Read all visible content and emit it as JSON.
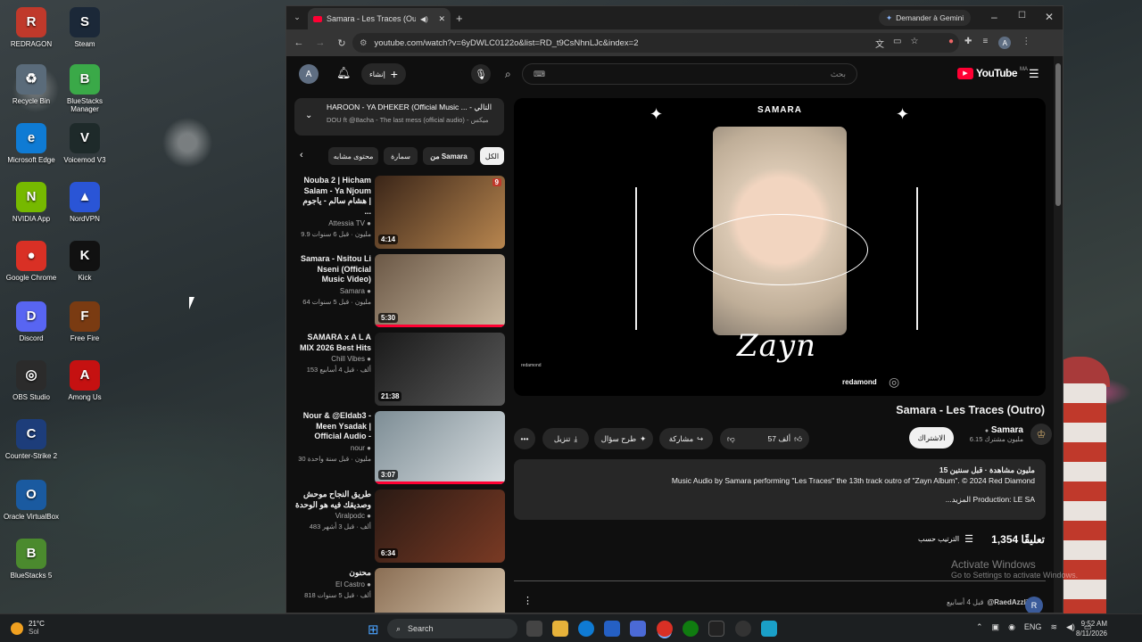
{
  "desktop": {
    "icons": [
      {
        "label": "REDRAGON",
        "glyph": "R",
        "color": "#c0392b"
      },
      {
        "label": "Steam",
        "glyph": "S",
        "color": "#1b2838"
      },
      {
        "label": "Recycle Bin",
        "glyph": "♻",
        "color": "#5a6b7a"
      },
      {
        "label": "BlueStacks Manager",
        "glyph": "B",
        "color": "#3aa948"
      },
      {
        "label": "Microsoft Edge",
        "glyph": "e",
        "color": "#0f7bd4"
      },
      {
        "label": "Voicemod V3",
        "glyph": "V",
        "color": "#1e2a2a"
      },
      {
        "label": "NVIDIA App",
        "glyph": "N",
        "color": "#76b900"
      },
      {
        "label": "NordVPN",
        "glyph": "▲",
        "color": "#2a55d6"
      },
      {
        "label": "Google Chrome",
        "glyph": "●",
        "color": "#d93025"
      },
      {
        "label": "Kick",
        "glyph": "K",
        "color": "#111"
      },
      {
        "label": "Discord",
        "glyph": "D",
        "color": "#5865f2"
      },
      {
        "label": "Free Fire",
        "glyph": "F",
        "color": "#7a3b12"
      },
      {
        "label": "OBS Studio",
        "glyph": "◎",
        "color": "#2b2b2b"
      },
      {
        "label": "Among Us",
        "glyph": "A",
        "color": "#c51111"
      },
      {
        "label": "Counter-Strike 2",
        "glyph": "C",
        "color": "#1d3d7a"
      },
      {
        "label": "Oracle VirtualBox",
        "glyph": "O",
        "color": "#1a5aa0"
      },
      {
        "label": "BlueStacks 5",
        "glyph": "B",
        "color": "#4b8a2e"
      }
    ]
  },
  "browser": {
    "tab_title": "Samara - Les Traces (Outro)",
    "gemini_label": "Demander à Gemini",
    "url": "youtube.com/watch?v=6yDWLC0122o&list=RD_t9CsNhnLJc&index=2",
    "profile_initial": "A"
  },
  "youtube": {
    "logo_text": "YouTube",
    "logo_sup": "MA",
    "create_label": "إنشاء",
    "search_placeholder": "بحث",
    "playlist": {
      "title": "HAROON - YA DHEKER (Official Music ... - التالي",
      "subtitle": "DOU ft @8acha - The last mess (official audio) - ميكس"
    },
    "chips": [
      "الكل",
      "من Samara",
      "سمارة",
      "محتوى مشابه"
    ],
    "related": [
      {
        "title": "Nouba 2 | Hicham Salam - Ya Njoum هشام سالم - ياجوم | ...",
        "channel": "Attessia TV",
        "stats": "9.9 مليون · قبل 6 سنوات",
        "duration": "4:14",
        "badge": "9",
        "colors": [
          "#3a2518",
          "#b8864f"
        ],
        "progress": 0
      },
      {
        "title": "Samara - Nsitou Li Nseni (Official Music Video)",
        "channel": "Samara",
        "stats": "64 مليون · قبل 5 سنوات",
        "duration": "5:30",
        "badge": "",
        "colors": [
          "#6b5846",
          "#c9b8a0"
        ],
        "progress": 100
      },
      {
        "title": "SAMARA x A L A MIX 2026 Best Hits",
        "channel": "Chill Vibes",
        "stats": "153 ألف · قبل 4 أسابيع",
        "duration": "21:38",
        "badge": "",
        "colors": [
          "#1a1a1a",
          "#5a5a5a"
        ],
        "progress": 0
      },
      {
        "title": "Nour & @Eldab3 - Meen Ysadak | Official Audio -",
        "channel": "nour",
        "stats": "30 مليون · قبل سنة واحدة",
        "duration": "3:07",
        "badge": "",
        "colors": [
          "#7d8d95",
          "#d7dde0"
        ],
        "progress": 100
      },
      {
        "title": "طريق النجاح موحش وصديقك فيه هو الوحدة",
        "channel": "Viralpodc",
        "stats": "483 ألف · قبل 3 أشهر",
        "duration": "6:34",
        "badge": "",
        "colors": [
          "#2a1a14",
          "#7a3a24"
        ],
        "progress": 0
      },
      {
        "title": "محنون",
        "channel": "El Castro",
        "stats": "818 ألف · قبل 5 سنوات",
        "duration": "",
        "badge": "",
        "colors": [
          "#8a6e54",
          "#e0cfb6"
        ],
        "progress": 0
      }
    ],
    "video": {
      "title": "Samara - Les Traces (Outro)",
      "thumb_top_text": "SAMARA",
      "thumb_big_text": "Zayn",
      "thumb_brand": "redamond",
      "channel": "Samara",
      "subscribers": "6.15 مليون مشترك",
      "subscribe_label": "الاشتراك",
      "likes": "57 ألف",
      "share_label": "مشاركة",
      "ask_label": "طرح سؤال",
      "download_label": "تنزيل",
      "views_line": "15 مليون مشاهدة · قبل سنتين",
      "description": "Music Audio by Samara performing \"Les Traces\" the 13th track outro of \"Zayn Album\". © 2024 Red Diamond",
      "production": "...المزيد Production: LE SA",
      "comments_count": "1,354 تعليقًا",
      "sort_label": "الترتيب حسب",
      "first_commenter": "@RaedAzzli",
      "first_comment_time": "قبل 4 أسابيع"
    }
  },
  "windows_watermark": {
    "line1": "Activate Windows",
    "line2": "Go to Settings to activate Windows."
  },
  "taskbar": {
    "weather_temp": "21°C",
    "weather_desc": "Sol",
    "search_label": "Search",
    "lang": "ENG",
    "time": "9:52 AM",
    "date": "8/11/2026"
  }
}
